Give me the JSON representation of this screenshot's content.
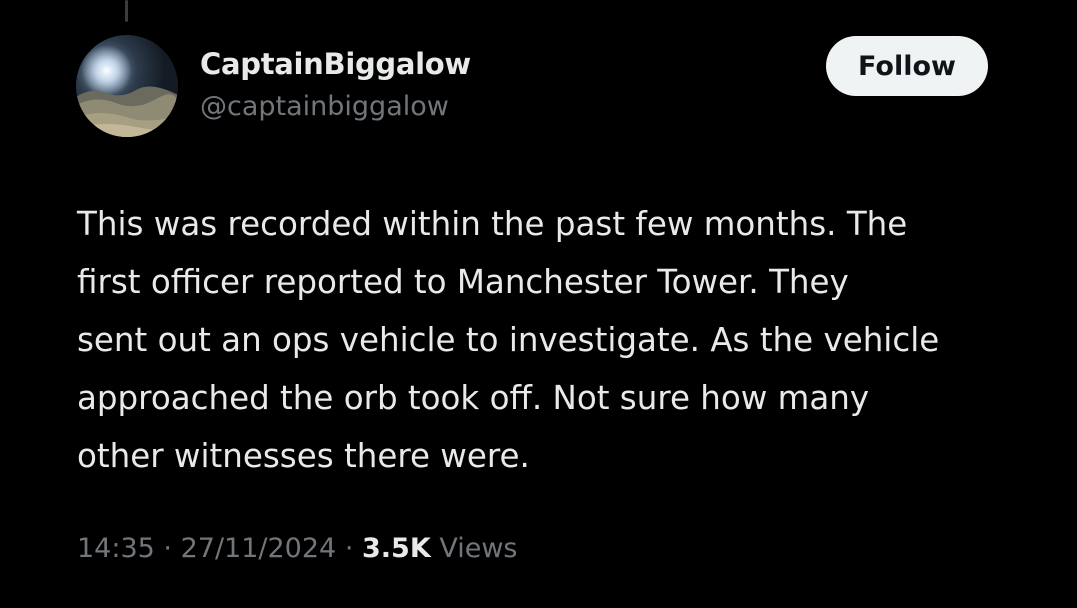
{
  "author": {
    "display_name": "CaptainBiggalow",
    "handle": "@captainbiggalow"
  },
  "follow_label": "Follow",
  "tweet": {
    "lines": [
      "This was recorded within the past few months.  The",
      "first officer reported to Manchester Tower. They",
      "sent out an ops vehicle to investigate. As the vehicle",
      "approached the orb took off. Not sure how many",
      "other witnesses there were."
    ]
  },
  "meta": {
    "time": "14:35",
    "separator": "·",
    "date": "27/11/2024",
    "views_count": "3.5K",
    "views_label": "Views"
  },
  "colors": {
    "background": "#000000",
    "primary_text": "#e7e9ea",
    "secondary_text": "#71767b",
    "button_bg": "#eff3f4"
  }
}
